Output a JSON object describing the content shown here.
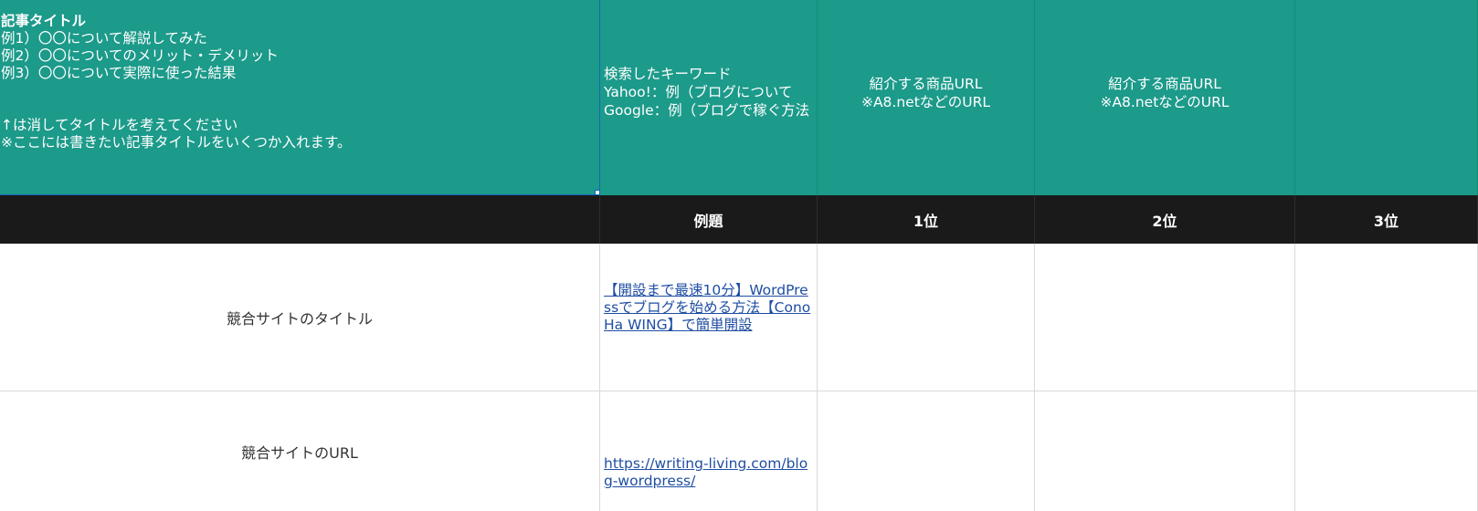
{
  "header": {
    "article_title": {
      "heading": "記事タイトル",
      "examples": [
        "例1）〇〇について解説してみた",
        "例2）〇〇についてのメリット・デメリット",
        "例3）〇〇について実際に使った結果"
      ],
      "notes": [
        "↑は消してタイトルを考えてください",
        "※ここには書きたい記事タイトルをいくつか入れます。"
      ]
    },
    "keyword": [
      "検索したキーワード",
      "Yahoo!：例（ブログについて",
      "Google：例（ブログで稼ぐ方法"
    ],
    "product_url_1": [
      "紹介する商品URL",
      "※A8.netなどのURL"
    ],
    "product_url_2": [
      "紹介する商品URL",
      "※A8.netなどのURL"
    ]
  },
  "ranks": [
    "例題",
    "1位",
    "2位",
    "3位"
  ],
  "rows": {
    "competitor_title": {
      "label": "競合サイトのタイトル",
      "example": "【開設まで最速10分】WordPressでブログを始める方法【ConoHa WING】で簡単開設"
    },
    "competitor_url": {
      "label": "競合サイトのURL",
      "example": "https://writing-living.com/blog-wordpress/"
    }
  },
  "colors": {
    "header_bg": "#1c9a8a",
    "rank_bg": "#1a1a1a",
    "link": "#1f4ea3",
    "selection": "#1565c0"
  }
}
